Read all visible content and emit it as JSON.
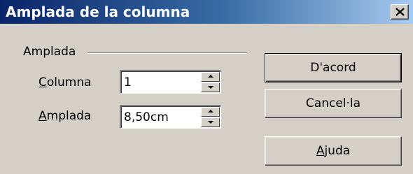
{
  "dialog": {
    "title": "Amplada de la columna",
    "close_label": "×"
  },
  "group": {
    "label": "Amplada"
  },
  "fields": {
    "column": {
      "label_mnemonic": "C",
      "label_rest": "olumna",
      "value": "1"
    },
    "width": {
      "label_mnemonic": "A",
      "label_rest": "mplada",
      "value": "8,50cm"
    }
  },
  "buttons": {
    "ok": "D'acord",
    "cancel": "Cancel·la",
    "help_mnemonic": "A",
    "help_rest": "juda"
  },
  "icons": {
    "close": "close-icon",
    "spin_up": "spin-up-icon",
    "spin_down": "spin-down-icon"
  }
}
